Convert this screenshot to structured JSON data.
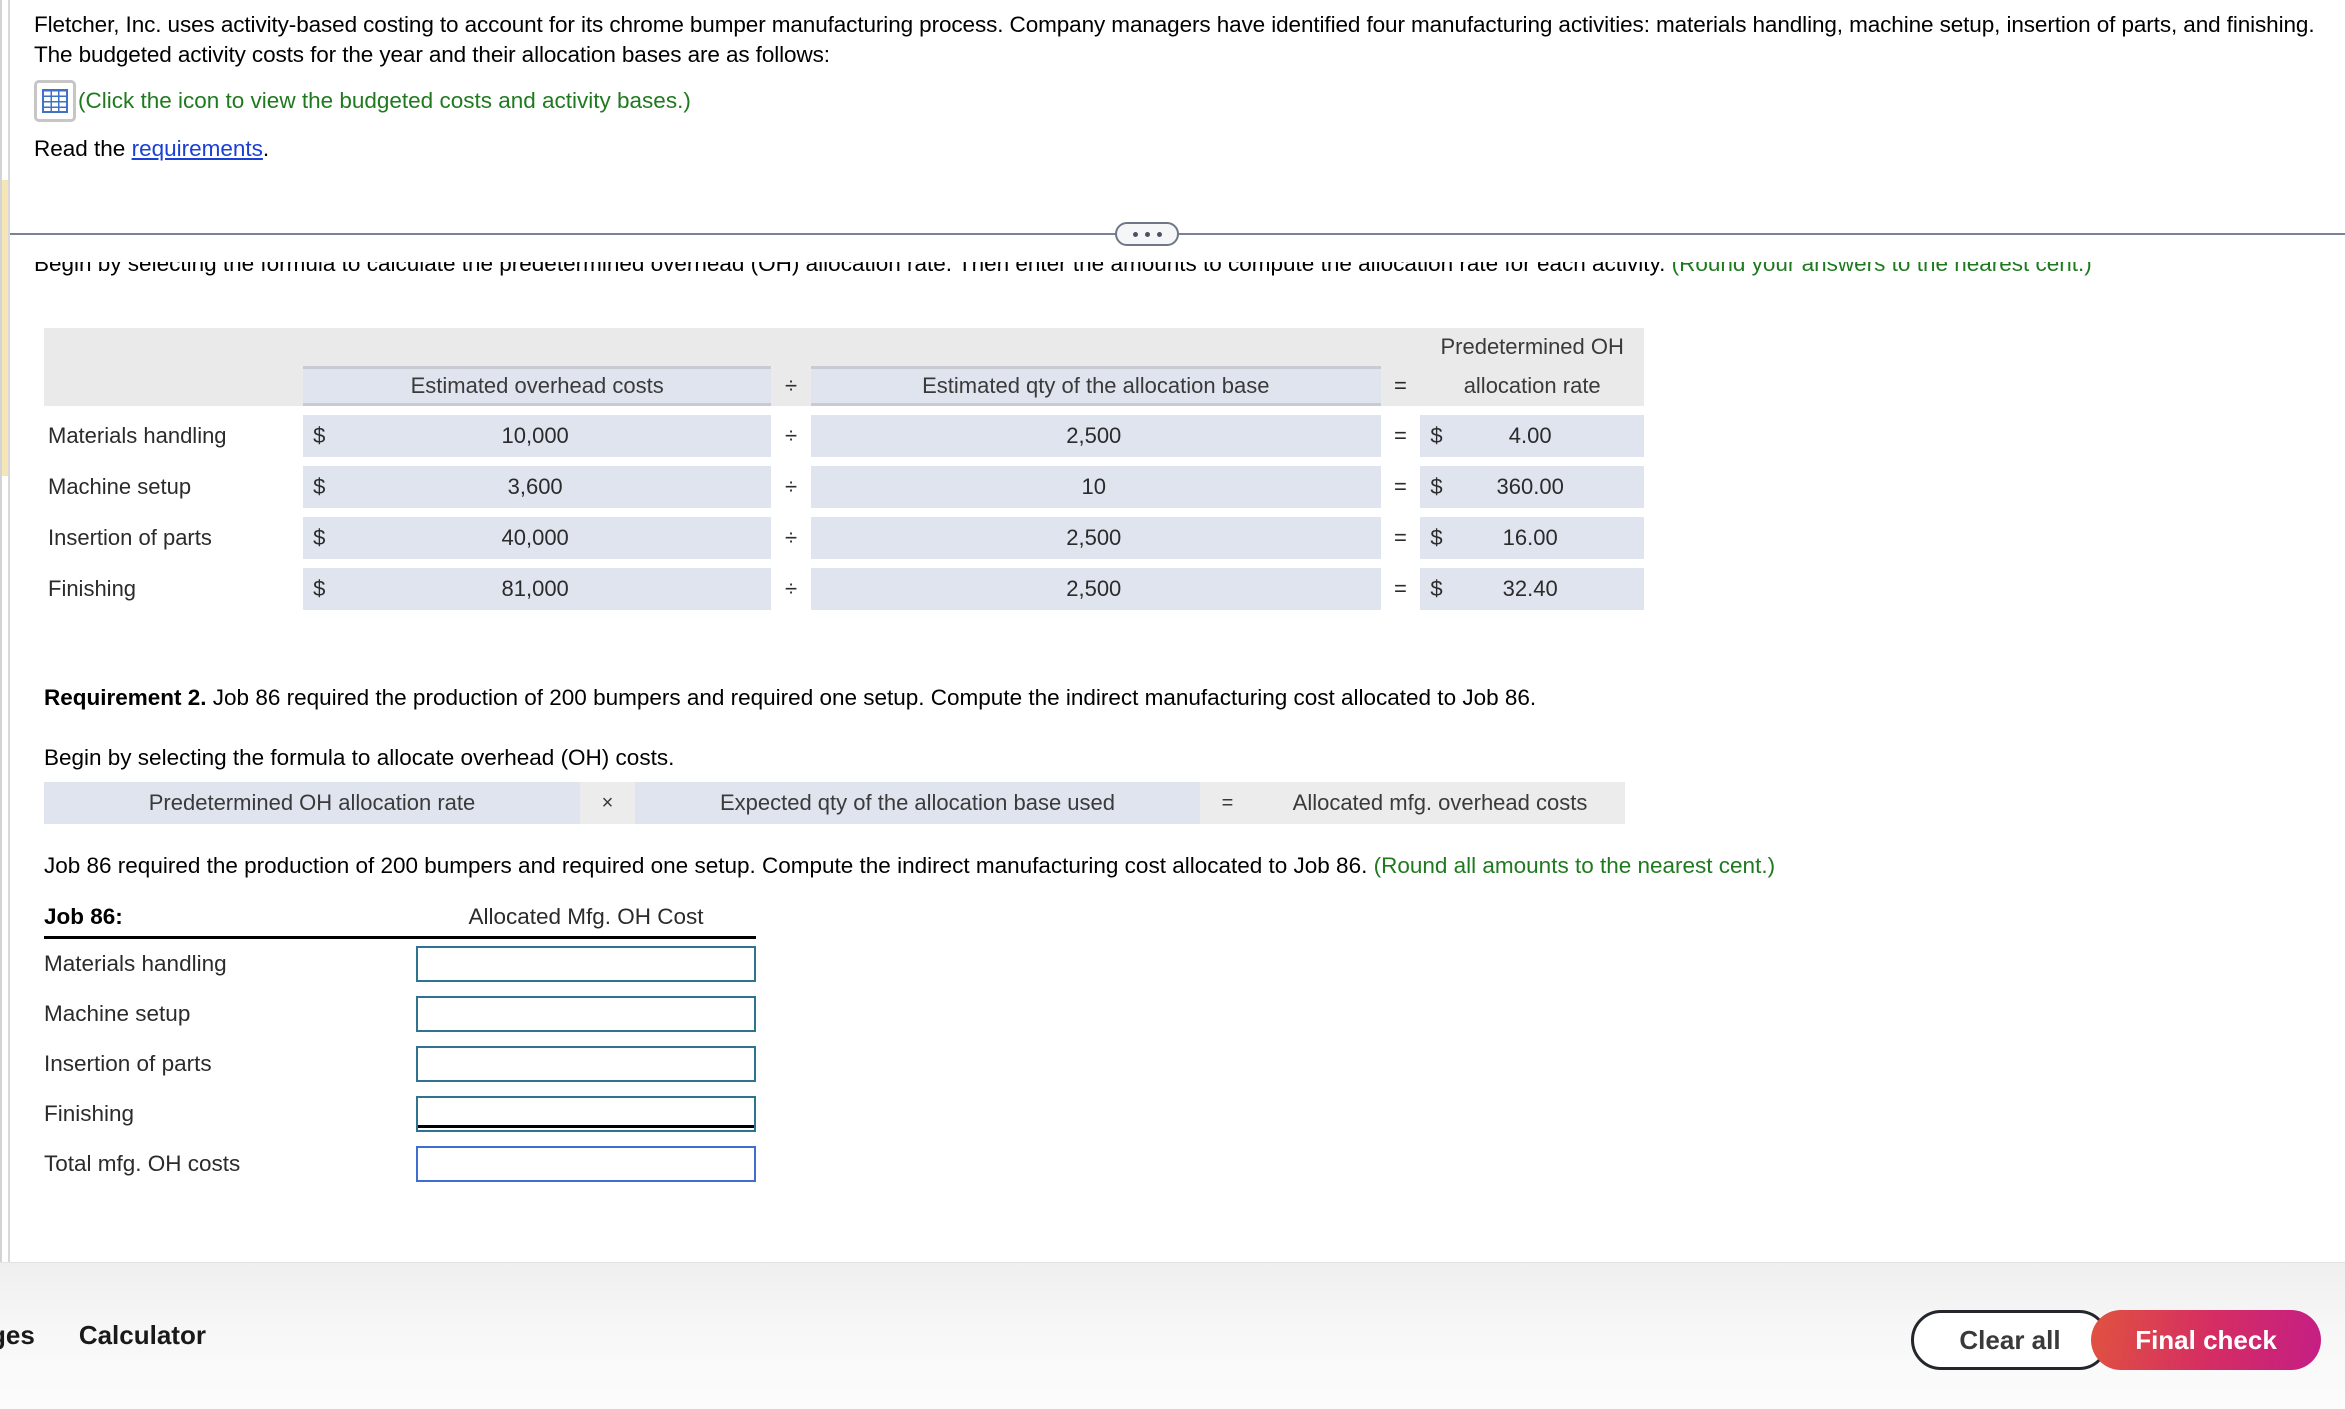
{
  "problem": {
    "paragraph": "Fletcher, Inc. uses activity-based costing to account for its chrome bumper manufacturing process. Company managers have identified four manufacturing activities: materials handling, machine setup, insertion of parts, and finishing. The budgeted activity costs for the year and their allocation bases are as follows:",
    "icon_name": "spreadsheet-grid-icon",
    "icon_note": "(Click the icon to view the budgeted costs and activity bases.)",
    "read_prefix": "Read the ",
    "read_link": "requirements",
    "read_suffix": "."
  },
  "requirement1": {
    "instruction_black": "Begin by selecting the formula to calculate the predetermined overhead (OH) allocation rate. Then enter the amounts to compute the allocation rate for each activity. ",
    "instruction_green": "(Round your answers to the nearest cent.)"
  },
  "rate_table": {
    "header": {
      "cost": "Estimated overhead costs",
      "divide_op": "÷",
      "qty": "Estimated qty of the allocation base",
      "equals_op": "=",
      "rate_line1": "Predetermined OH",
      "rate_line2": "allocation rate"
    },
    "rows": [
      {
        "label": "Materials handling",
        "cost_symbol": "$",
        "cost": "10,000",
        "op1": "÷",
        "qty": "2,500",
        "op2": "=",
        "rate_symbol": "$",
        "rate": "4.00"
      },
      {
        "label": "Machine setup",
        "cost_symbol": "$",
        "cost": "3,600",
        "op1": "÷",
        "qty": "10",
        "op2": "=",
        "rate_symbol": "$",
        "rate": "360.00"
      },
      {
        "label": "Insertion of parts",
        "cost_symbol": "$",
        "cost": "40,000",
        "op1": "÷",
        "qty": "2,500",
        "op2": "=",
        "rate_symbol": "$",
        "rate": "16.00"
      },
      {
        "label": "Finishing",
        "cost_symbol": "$",
        "cost": "81,000",
        "op1": "÷",
        "qty": "2,500",
        "op2": "=",
        "rate_symbol": "$",
        "rate": "32.40"
      }
    ]
  },
  "requirement2": {
    "bold_label": "Requirement 2.",
    "text": " Job 86 required the production of 200 bumpers and required one setup. Compute the indirect manufacturing cost allocated to Job 86.",
    "begin_text": "Begin by selecting the formula to allocate overhead (OH) costs.",
    "formula": {
      "part_a": "Predetermined OH allocation rate",
      "op1": "×",
      "part_b": "Expected qty of the allocation base used",
      "op2": "=",
      "part_c": "Allocated mfg. overhead costs"
    },
    "job_intro_black": "Job 86 required the production of 200 bumpers and required one setup. Compute the indirect manufacturing cost allocated to Job 86. ",
    "job_intro_green": "(Round all amounts to the nearest cent.)"
  },
  "job_table": {
    "head_left": "Job 86:",
    "head_right": "Allocated Mfg. OH Cost",
    "rows": [
      {
        "label": "Materials handling",
        "value": "",
        "focused": false,
        "subtotal_rule": false
      },
      {
        "label": "Machine setup",
        "value": "",
        "focused": false,
        "subtotal_rule": false
      },
      {
        "label": "Insertion of parts",
        "value": "",
        "focused": false,
        "subtotal_rule": false
      },
      {
        "label": "Finishing",
        "value": "",
        "focused": false,
        "subtotal_rule": true
      },
      {
        "label": "Total mfg. OH costs",
        "value": "",
        "focused": true,
        "subtotal_rule": false
      }
    ]
  },
  "toolbar": {
    "left_clipped": "ges",
    "calculator": "Calculator",
    "clear_all": "Clear all",
    "final_check": "Final check"
  },
  "colors": {
    "green_note": "#1f7a1f",
    "link_blue": "#1a3fd4",
    "dropdown_fill": "#dfe4ef",
    "header_band": "#eaeaea",
    "input_border": "#2e7491",
    "input_border_focus": "#3e6fd0",
    "final_check_gradient_start": "#e0533f",
    "final_check_gradient_end": "#c41e86"
  }
}
